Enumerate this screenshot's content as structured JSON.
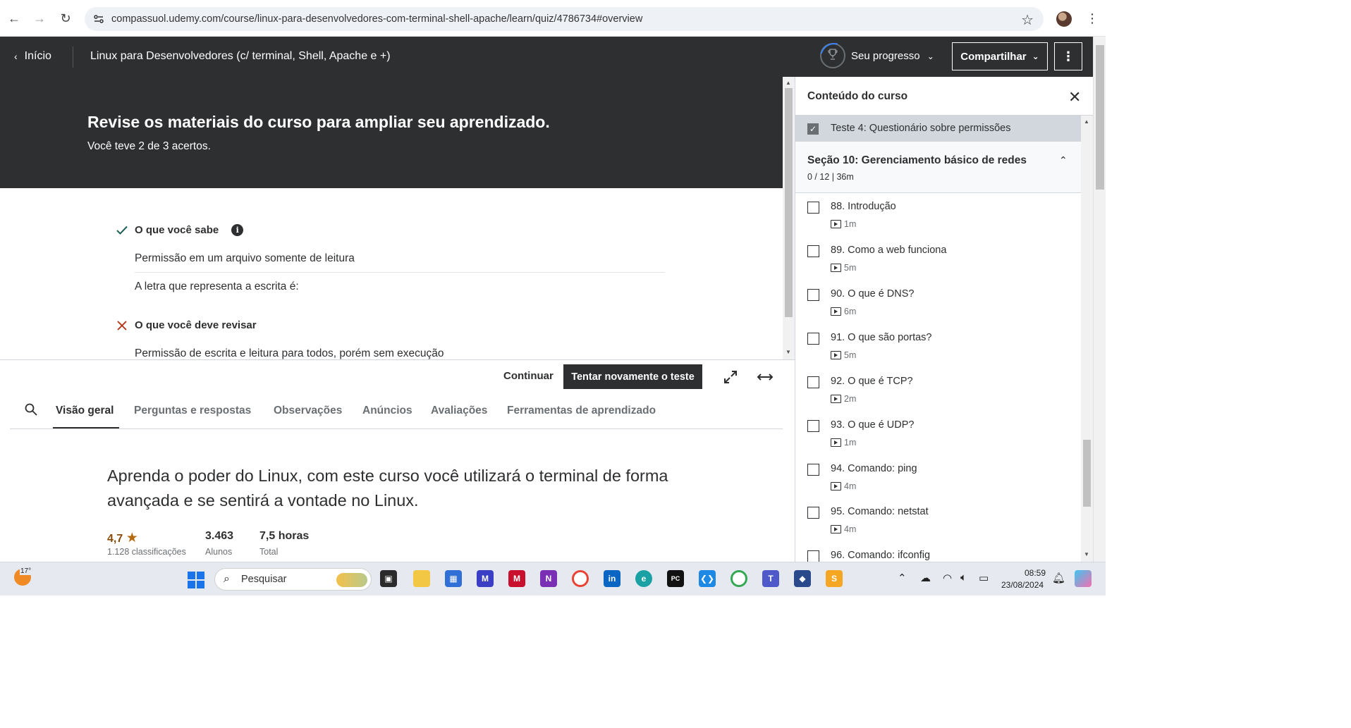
{
  "browser": {
    "url": "compassuol.udemy.com/course/linux-para-desenvolvedores-com-terminal-shell-apache/learn/quiz/4786734#overview"
  },
  "header": {
    "back_label": "Início",
    "course_title": "Linux para Desenvolvedores (c/ terminal, Shell, Apache e +)",
    "progress_label": "Seu progresso",
    "share_label": "Compartilhar",
    "more_label": "⋮"
  },
  "quiz": {
    "heading": "Revise os materiais do curso para ampliar seu aprendizado.",
    "score_text": "Você teve 2 de 3 acertos.",
    "known_heading": "O que você sabe",
    "known_items": [
      "Permissão em um arquivo somente de leitura",
      "A letra que representa a escrita é:"
    ],
    "review_heading": "O que você deve revisar",
    "review_items": [
      "Permissão de escrita e leitura para todos, porém sem execução"
    ]
  },
  "actions": {
    "continue_label": "Continuar",
    "retry_label": "Tentar novamente o teste"
  },
  "tabs": [
    {
      "label": "Visão geral",
      "active": true
    },
    {
      "label": "Perguntas e respostas",
      "active": false
    },
    {
      "label": "Observações",
      "active": false
    },
    {
      "label": "Anúncios",
      "active": false
    },
    {
      "label": "Avaliações",
      "active": false
    },
    {
      "label": "Ferramentas de aprendizado",
      "active": false
    }
  ],
  "overview": {
    "headline": "Aprenda o poder do Linux, com este curso você utilizará o terminal de forma avançada e se sentirá a vontade no Linux.",
    "rating_value": "4,7",
    "rating_count": "1.128 classificações",
    "students_value": "3.463",
    "students_label": "Alunos",
    "hours_value": "7,5 horas",
    "hours_label": "Total"
  },
  "sidebar": {
    "title": "Conteúdo do curso",
    "completed_quiz": "Teste 4: Questionário sobre permissões",
    "section_title": "Seção 10: Gerenciamento básico de redes",
    "section_meta": "0 / 12 | 36m",
    "lectures": [
      {
        "title": "88. Introdução",
        "duration": "1m"
      },
      {
        "title": "89. Como a web funciona",
        "duration": "5m"
      },
      {
        "title": "90. O que é DNS?",
        "duration": "6m"
      },
      {
        "title": "91. O que são portas?",
        "duration": "5m"
      },
      {
        "title": "92. O que é TCP?",
        "duration": "2m"
      },
      {
        "title": "93. O que é UDP?",
        "duration": "1m"
      },
      {
        "title": "94. Comando: ping",
        "duration": "4m"
      },
      {
        "title": "95. Comando: netstat",
        "duration": "4m"
      },
      {
        "title": "96. Comando: ifconfig",
        "duration": ""
      }
    ]
  },
  "taskbar": {
    "temperature": "17°",
    "search_placeholder": "Pesquisar",
    "time": "08:59",
    "date": "23/08/2024"
  },
  "colors": {
    "dark_header": "#2d2f31",
    "success_green": "#1e6055",
    "error_red": "#b32d0f",
    "rating_star": "#b4690e"
  }
}
